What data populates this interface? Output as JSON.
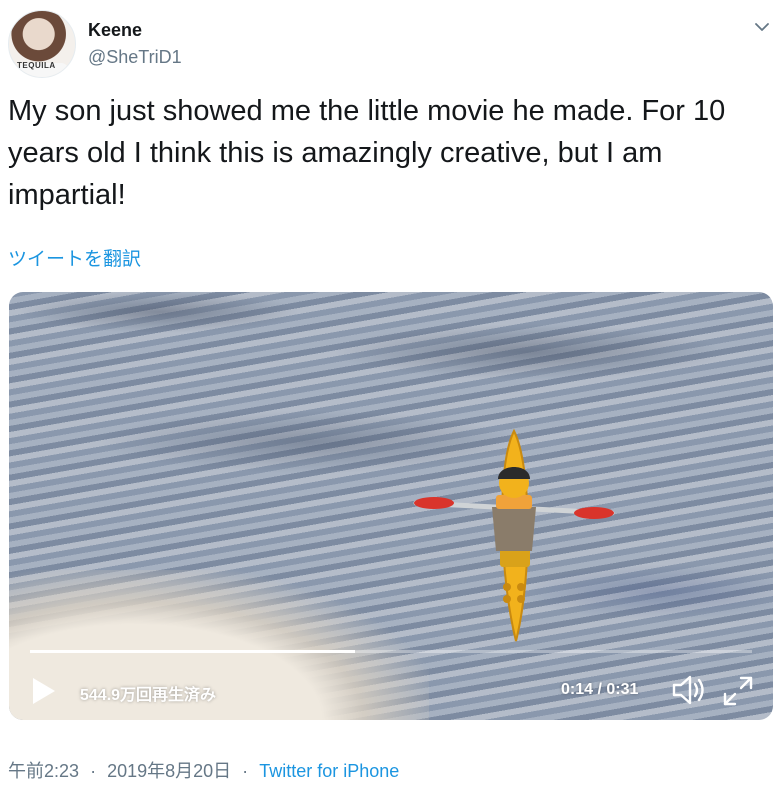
{
  "author": {
    "name": "Keene",
    "handle": "@SheTriD1",
    "avatar_shirt_text": "TEQUILA"
  },
  "tweet": {
    "text": "My son just showed me the little movie he made. For 10 years old I think this is amazingly creative, but I am impartial!",
    "translate_label": "ツイートを翻訳"
  },
  "video": {
    "view_count": "544.9万回再生済み",
    "time_display": "0:14 / 0:31",
    "progress": 0.45,
    "controls": {
      "play_icon": "play-icon",
      "volume_icon": "volume-icon",
      "fullscreen_icon": "fullscreen-icon"
    }
  },
  "meta": {
    "time": "午前2:23",
    "date": "2019年8月20日",
    "separator": "·",
    "source": "Twitter for iPhone"
  },
  "colors": {
    "link": "#1b95e0",
    "secondary_text": "#657786",
    "kayak": "#f2b21c",
    "paddle": "#d9342b"
  }
}
